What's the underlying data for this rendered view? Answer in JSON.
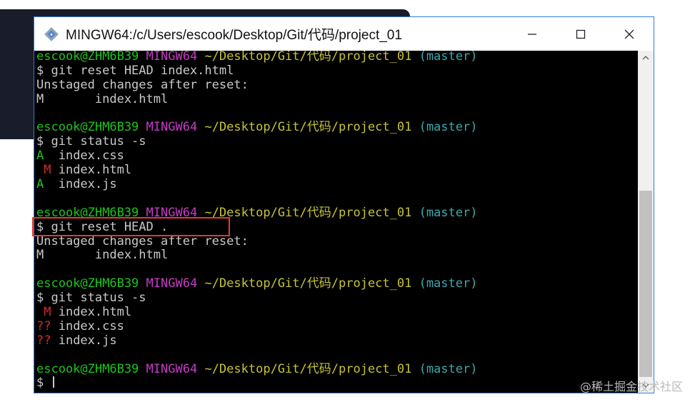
{
  "window": {
    "title": "MINGW64:/c/Users/escook/Desktop/Git/代码/project_01"
  },
  "terminal": {
    "lines": [
      [
        {
          "t": "escook@ZHM6B39",
          "c": "g"
        },
        {
          "t": " ",
          "c": "w"
        },
        {
          "t": "MINGW64",
          "c": "m"
        },
        {
          "t": " ",
          "c": "w"
        },
        {
          "t": "~/Desktop/Git/代码/project_01",
          "c": "y"
        },
        {
          "t": " ",
          "c": "w"
        },
        {
          "t": "(master)",
          "c": "c"
        }
      ],
      [
        {
          "t": "$ git reset HEAD index.html",
          "c": "w"
        }
      ],
      [
        {
          "t": "Unstaged changes after reset:",
          "c": "w"
        }
      ],
      [
        {
          "t": "M       index.html",
          "c": "w"
        }
      ],
      [],
      [
        {
          "t": "escook@ZHM6B39",
          "c": "g"
        },
        {
          "t": " ",
          "c": "w"
        },
        {
          "t": "MINGW64",
          "c": "m"
        },
        {
          "t": " ",
          "c": "w"
        },
        {
          "t": "~/Desktop/Git/代码/project_01",
          "c": "y"
        },
        {
          "t": " ",
          "c": "w"
        },
        {
          "t": "(master)",
          "c": "c"
        }
      ],
      [
        {
          "t": "$ git status -s",
          "c": "w"
        }
      ],
      [
        {
          "t": "A",
          "c": "g"
        },
        {
          "t": "  index.css",
          "c": "w"
        }
      ],
      [
        {
          "t": " M",
          "c": "r"
        },
        {
          "t": " index.html",
          "c": "w"
        }
      ],
      [
        {
          "t": "A",
          "c": "g"
        },
        {
          "t": "  index.js",
          "c": "w"
        }
      ],
      [],
      [
        {
          "t": "escook@ZHM6B39",
          "c": "g"
        },
        {
          "t": " ",
          "c": "w"
        },
        {
          "t": "MINGW64",
          "c": "m"
        },
        {
          "t": " ",
          "c": "w"
        },
        {
          "t": "~/Desktop/Git/代码/project_01",
          "c": "y"
        },
        {
          "t": " ",
          "c": "w"
        },
        {
          "t": "(master)",
          "c": "c"
        }
      ],
      [
        {
          "t": "$ git reset HEAD .",
          "c": "w"
        }
      ],
      [
        {
          "t": "Unstaged changes after reset:",
          "c": "w"
        }
      ],
      [
        {
          "t": "M       index.html",
          "c": "w"
        }
      ],
      [],
      [
        {
          "t": "escook@ZHM6B39",
          "c": "g"
        },
        {
          "t": " ",
          "c": "w"
        },
        {
          "t": "MINGW64",
          "c": "m"
        },
        {
          "t": " ",
          "c": "w"
        },
        {
          "t": "~/Desktop/Git/代码/project_01",
          "c": "y"
        },
        {
          "t": " ",
          "c": "w"
        },
        {
          "t": "(master)",
          "c": "c"
        }
      ],
      [
        {
          "t": "$ git status -s",
          "c": "w"
        }
      ],
      [
        {
          "t": " M",
          "c": "r"
        },
        {
          "t": " index.html",
          "c": "w"
        }
      ],
      [
        {
          "t": "??",
          "c": "r"
        },
        {
          "t": " index.css",
          "c": "w"
        }
      ],
      [
        {
          "t": "??",
          "c": "r"
        },
        {
          "t": " index.js",
          "c": "w"
        }
      ],
      [],
      [
        {
          "t": "escook@ZHM6B39",
          "c": "g"
        },
        {
          "t": " ",
          "c": "w"
        },
        {
          "t": "MINGW64",
          "c": "m"
        },
        {
          "t": " ",
          "c": "w"
        },
        {
          "t": "~/Desktop/Git/代码/project_01",
          "c": "y"
        },
        {
          "t": " ",
          "c": "w"
        },
        {
          "t": "(master)",
          "c": "c"
        }
      ],
      [
        {
          "t": "$ ",
          "c": "w"
        }
      ]
    ]
  },
  "colors": {
    "user_host": "#1cc41c",
    "mingw": "#c43cc4",
    "path": "#c7c336",
    "branch": "#39aaaf",
    "text": "#c9c9c9",
    "untracked": "#d62b2b",
    "highlight_box": "#e53935"
  },
  "icons": {
    "app": "git-bash-diamond-icon",
    "minimize": "minimize-icon",
    "maximize": "maximize-icon",
    "close": "close-icon",
    "scroll_up": "chevron-up-icon",
    "scroll_down": "chevron-down-icon"
  },
  "watermark": "@稀土掘金技术社区"
}
